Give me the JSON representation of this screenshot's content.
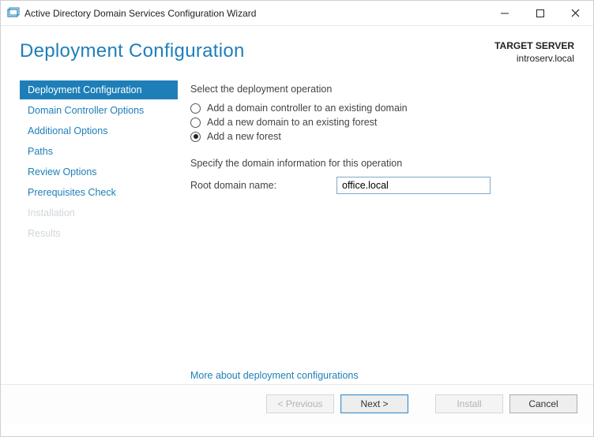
{
  "window": {
    "title": "Active Directory Domain Services Configuration Wizard"
  },
  "header": {
    "page_title": "Deployment Configuration",
    "target_label": "TARGET SERVER",
    "target_value": "introserv.local"
  },
  "sidebar": {
    "items": [
      {
        "label": "Deployment Configuration",
        "state": "active"
      },
      {
        "label": "Domain Controller Options",
        "state": "normal"
      },
      {
        "label": "Additional Options",
        "state": "normal"
      },
      {
        "label": "Paths",
        "state": "normal"
      },
      {
        "label": "Review Options",
        "state": "normal"
      },
      {
        "label": "Prerequisites Check",
        "state": "normal"
      },
      {
        "label": "Installation",
        "state": "disabled"
      },
      {
        "label": "Results",
        "state": "disabled"
      }
    ]
  },
  "content": {
    "operation_label": "Select the deployment operation",
    "options": [
      {
        "label": "Add a domain controller to an existing domain",
        "selected": false
      },
      {
        "label": "Add a new domain to an existing forest",
        "selected": false
      },
      {
        "label": "Add a new forest",
        "selected": true
      }
    ],
    "domain_info_label": "Specify the domain information for this operation",
    "root_domain_label": "Root domain name:",
    "root_domain_value": "office.local",
    "more_link": "More about deployment configurations"
  },
  "footer": {
    "previous": "< Previous",
    "next": "Next >",
    "install": "Install",
    "cancel": "Cancel"
  }
}
